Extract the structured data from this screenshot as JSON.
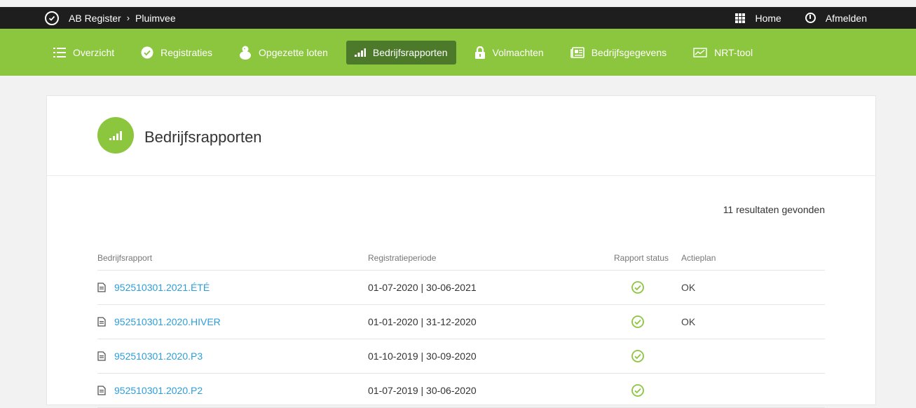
{
  "topbar": {
    "breadcrumb_root": "AB Register",
    "breadcrumb_separator": "›",
    "breadcrumb_current": "Pluimvee",
    "home_label": "Home",
    "logout_label": "Afmelden"
  },
  "nav": {
    "items": [
      {
        "label": "Overzicht",
        "icon": "list-icon"
      },
      {
        "label": "Registraties",
        "icon": "check-circle-icon"
      },
      {
        "label": "Opgezette loten",
        "icon": "chick-icon"
      },
      {
        "label": "Bedrijfsrapporten",
        "icon": "bar-chart-icon",
        "active": true
      },
      {
        "label": "Volmachten",
        "icon": "lock-icon"
      },
      {
        "label": "Bedrijfsgegevens",
        "icon": "newspaper-icon"
      },
      {
        "label": "NRT-tool",
        "icon": "line-chart-icon"
      }
    ]
  },
  "page": {
    "title": "Bedrijfsrapporten",
    "results_text": "11 resultaten gevonden"
  },
  "table": {
    "headers": [
      "Bedrijfsrapport",
      "Registratieperiode",
      "Rapport status",
      "Actieplan"
    ],
    "rows": [
      {
        "report": "952510301.2021.ÉTÉ",
        "period": "01-07-2020 | 30-06-2021",
        "status": "ok-check",
        "actieplan": "OK"
      },
      {
        "report": "952510301.2020.HIVER",
        "period": "01-01-2020 | 31-12-2020",
        "status": "ok-check",
        "actieplan": "OK"
      },
      {
        "report": "952510301.2020.P3",
        "period": "01-10-2019 | 30-09-2020",
        "status": "ok-check",
        "actieplan": ""
      },
      {
        "report": "952510301.2020.P2",
        "period": "01-07-2019 | 30-06-2020",
        "status": "ok-check",
        "actieplan": ""
      }
    ]
  },
  "colors": {
    "brand_green": "#8cc63e",
    "active_nav": "#4c7a2a",
    "link_blue": "#2d9ed9",
    "topbar_bg": "#1e1e1e"
  }
}
